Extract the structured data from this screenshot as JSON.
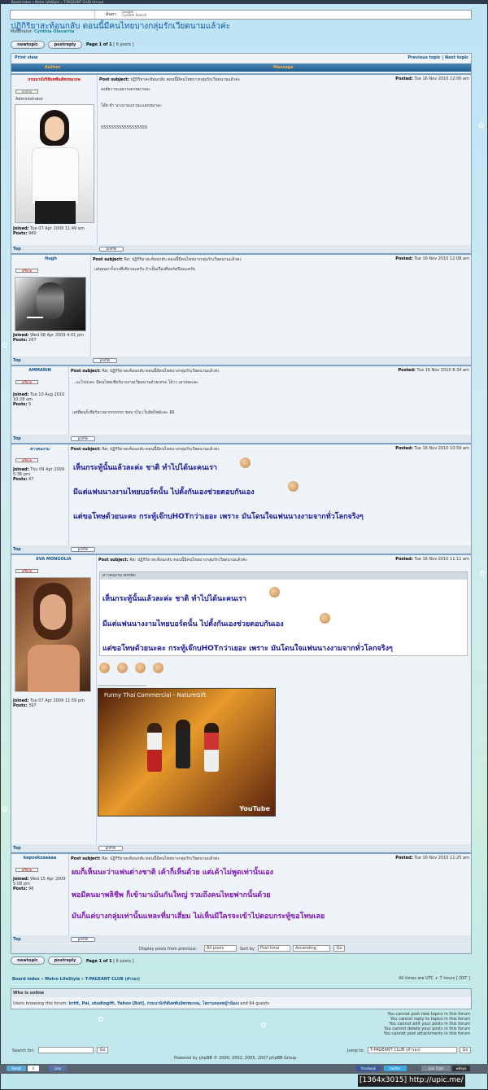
{
  "window": {
    "titlebar": "Board index » Metro LifeStyle » T-PAGEANT CLUB (สำรอง)"
  },
  "search": {
    "button": "ค้นหา",
    "google": "Google",
    "google_sub": "Custom Search"
  },
  "topic": {
    "title": "ปฏิกิริยาสะท้อนกลับ ตอนนี้มีคนไทยบางกลุ่มรักเวียดนามแล้วค่ะ",
    "moderator_label": "Moderator:",
    "moderator": "Cynthia Olavarria"
  },
  "buttons": {
    "newtopic": "newtopic",
    "postreply": "postreply",
    "profile": "profile"
  },
  "pagination": {
    "text": "Page 1 of 1",
    "posts": "[ 6 posts ]"
  },
  "nav": {
    "print": "Print view",
    "prev": "Previous topic",
    "sep": "|",
    "next": "Next topic"
  },
  "table": {
    "author": "Author",
    "message": "Message"
  },
  "labels": {
    "post_subject": "Post subject:",
    "posted": "Posted:",
    "joined": "Joined:",
    "posts": "Posts:",
    "top": "Top",
    "wrote": "wrote:"
  },
  "posts": [
    {
      "author": "กรมนามังกิสันทพันธ์พรหมรงษ",
      "status": "online",
      "rank": "Administrator",
      "subject": "ปฏิกิริยาสะท้อนกลับ ตอนนี้มีคนไทยบางกลุ่มรักเวียดนามแล้วค่ะ",
      "date": "Tue 16 Nov 2010 12:06 am",
      "joined": "Tue 07 Apr 2009 11:49 am",
      "posts": "960",
      "lines": [
        "ลงสัยวาจะอยากเดกหมานอะ",
        "โอ๊ย ชำ นางงามแกวนะแลกหมาอะ",
        "555555555555555555"
      ]
    },
    {
      "author": "Hugh",
      "status": "offline",
      "subject": "Re: ปฏิกิริยาสะท้อนกลับ ตอนนี้มีคนไทยบางกลุ่มรักเวียดนามแล้วค่ะ",
      "date": "Tue 16 Nov 2010 12:08 am",
      "joined": "Wed 08 Apr 2009 4:01 pm",
      "posts": "267",
      "lines": [
        "แต่คุณมาก็แรงที่เดียวนะครับ ถ้าเป็นเรื่องที่บอร์ดปีนนะครับ"
      ]
    },
    {
      "author": "AMMARIN",
      "status": "offline",
      "subject": "Re: ปฏิกิริยาสะท้อนกลับ ตอนนี้มีคนไทยบางกลุ่มรักเวียดนามแล้วค่ะ",
      "date": "Tue 16 Nov 2010 8:34 am",
      "joined": "Tue 10 Aug 2010 10:28 am",
      "posts": "5",
      "lines": [
        "...อะไรน่ะคะ มีคนไทยเชียร์นางงามเวียดนามด้วยเหรอ โอ้วว เอาเหอะคะ",
        "แต่ที่คนก็เชียร์นางมากกกกกก ชอบ ๆไน เว็บอิสไซด์ะคะ อิอิ"
      ]
    },
    {
      "author": "สาวคนงาม",
      "status": "offline",
      "subject": "Re: ปฏิกิริยาสะท้อนกลับ ตอนนี้มีคนไทยบางกลุ่มรักเวียดนามแล้วค่ะ",
      "date": "Tue 16 Nov 2010 10:59 am",
      "joined": "Thu 09 Apr 2009 5:36 pm",
      "posts": "47",
      "lines": [
        "เห็นกระทู้นั้นแล้วละค่ะ ชาติ ทำไปได้นะคนเรา",
        "มีแต่แฟนนางงามไทยบอร์ดนั้น ไปตั้งกันเองช่วยตอบกันเอง",
        "แต่ขอโทษด้วยนะคะ กระทู้เจ๊กบHOTกว่าเยอะ เพราะ มันโดนใจแฟนนางงามจากทั่วโลกจริงๆ"
      ]
    },
    {
      "author": "EVA MONGOLIA",
      "status": "offline",
      "subject": "Re: ปฏิกิริยาสะท้อนกลับ ตอนนี้มีคนไทยบางกลุ่มรักเวียดนามแล้วค่ะ",
      "date": "Tue 16 Nov 2010 11:11 am",
      "joined": "Tue 07 Apr 2009 11:59 pm",
      "posts": "397",
      "quote_author": "สาวคนงาม",
      "lines": [
        "เห็นกระทู้นั้นแล้วละค่ะ ชาติ ทำไปได้นะคนเรา",
        "มีแต่แฟนนางงามไทยบอร์ดนั้น ไปตั้งกันเองช่วยตอบกันเอง",
        "แต่ขอโทษด้วยนะคะ กระทู้เจ๊กบHOTกว่าเยอะ เพราะ มันโดนใจแฟนนางงามจากทั่วโลกจริงๆ"
      ],
      "video_title": "Funny Thai Commercial - NatureGift",
      "video_logo": "YouTube"
    },
    {
      "author": "kapookzaaaaa",
      "status": "offline",
      "subject": "Re: ปฏิกิริยาสะท้อนกลับ ตอนนี้มีคนไทยบางกลุ่มรักเวียดนามแล้วค่ะ",
      "date": "Tue 16 Nov 2010 11:25 am",
      "joined": "Wed 15 Apr 2009 5:08 pm",
      "posts": "96",
      "lines": [
        "ผมก็เห็นนะว่าแฟนต่างชาติ เค้าก็เห็นด้วย แต่เค้าไม่พูดเท่านั้นเอง",
        "พอมีคนมาพลิชีพ ก็เข้ามาเม้นกันใหญ่ รวมถึงคนไทยฟากนั้นด้วย",
        "มันก็แค่บางกลุ่มเท่านั้นแหละที่มาเสี่ยม ไม่เห็นมีใครจะเข้าไปตอบกระทู้ขอโทษเลย"
      ]
    }
  ],
  "sort": {
    "label": "Display posts from previous:",
    "from": "All posts",
    "sort_label": "Sort by",
    "by": "Post time",
    "order": "Ascending",
    "go": "Go"
  },
  "breadcrumb": {
    "a": "Board index",
    "sep": "»",
    "b": "Metro LifeStyle",
    "c": "T-PAGEANT CLUB (สำรอง)",
    "tz": "All times are UTC + 7 hours [ DST ]"
  },
  "online": {
    "title": "Who is online",
    "prefix": "Users browsing this forum:",
    "users": "kritt, Pai, studiogift, Yahoo [Bot], กรมนามังกิสันทพันธ์พรหมรงษ, โลกานจองหญ้าน้องง",
    "suffix": "and 64 guests"
  },
  "permissions": [
    "You cannot post new topics in this forum",
    "You cannot reply to topics in this forum",
    "You cannot edit your posts in this forum",
    "You cannot delete your posts in this forum",
    "You cannot post attachments in this forum"
  ],
  "footer": {
    "search_label": "Search for:",
    "go": "Go",
    "jump_label": "Jump to:",
    "jump_value": "T-PAGEANT CLUB (สำรอง)",
    "powered": "Powered by phpBB © 2000, 2002, 2005, 2007 phpBB Group"
  },
  "social": {
    "tweet": "Tweet",
    "tweet_count": "0",
    "like": "Like",
    "facebook": "facebook",
    "twitter": "twitter",
    "chat": "Join Chat",
    "wibiya": "wibiya"
  },
  "caption": "[1364x3015] http://upic.me/",
  "colors": {
    "header": "#1f5d8e",
    "accent": "#ffb347",
    "link": "#105289",
    "bigtext": "#1a1a99",
    "purple": "#7f16b7"
  }
}
